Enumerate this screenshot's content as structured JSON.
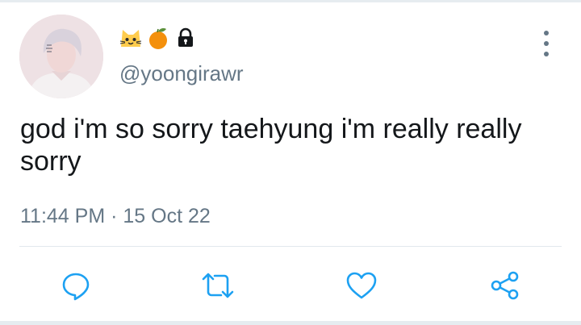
{
  "tweet": {
    "handle": "@yoongirawr",
    "display_name_emojis": [
      "cat-face-emoji",
      "tangerine-emoji",
      "lock-icon"
    ],
    "text": "god i'm so sorry taehyung i'm really really sorry",
    "time": "11:44 PM",
    "separator": " · ",
    "date": "15 Oct 22"
  },
  "actions": [
    "reply-icon",
    "retweet-icon",
    "like-icon",
    "share-icon"
  ],
  "colors": {
    "text": "#14171a",
    "secondary": "#657786",
    "icon": "#1da1f2",
    "divider": "#e1e8ed"
  }
}
